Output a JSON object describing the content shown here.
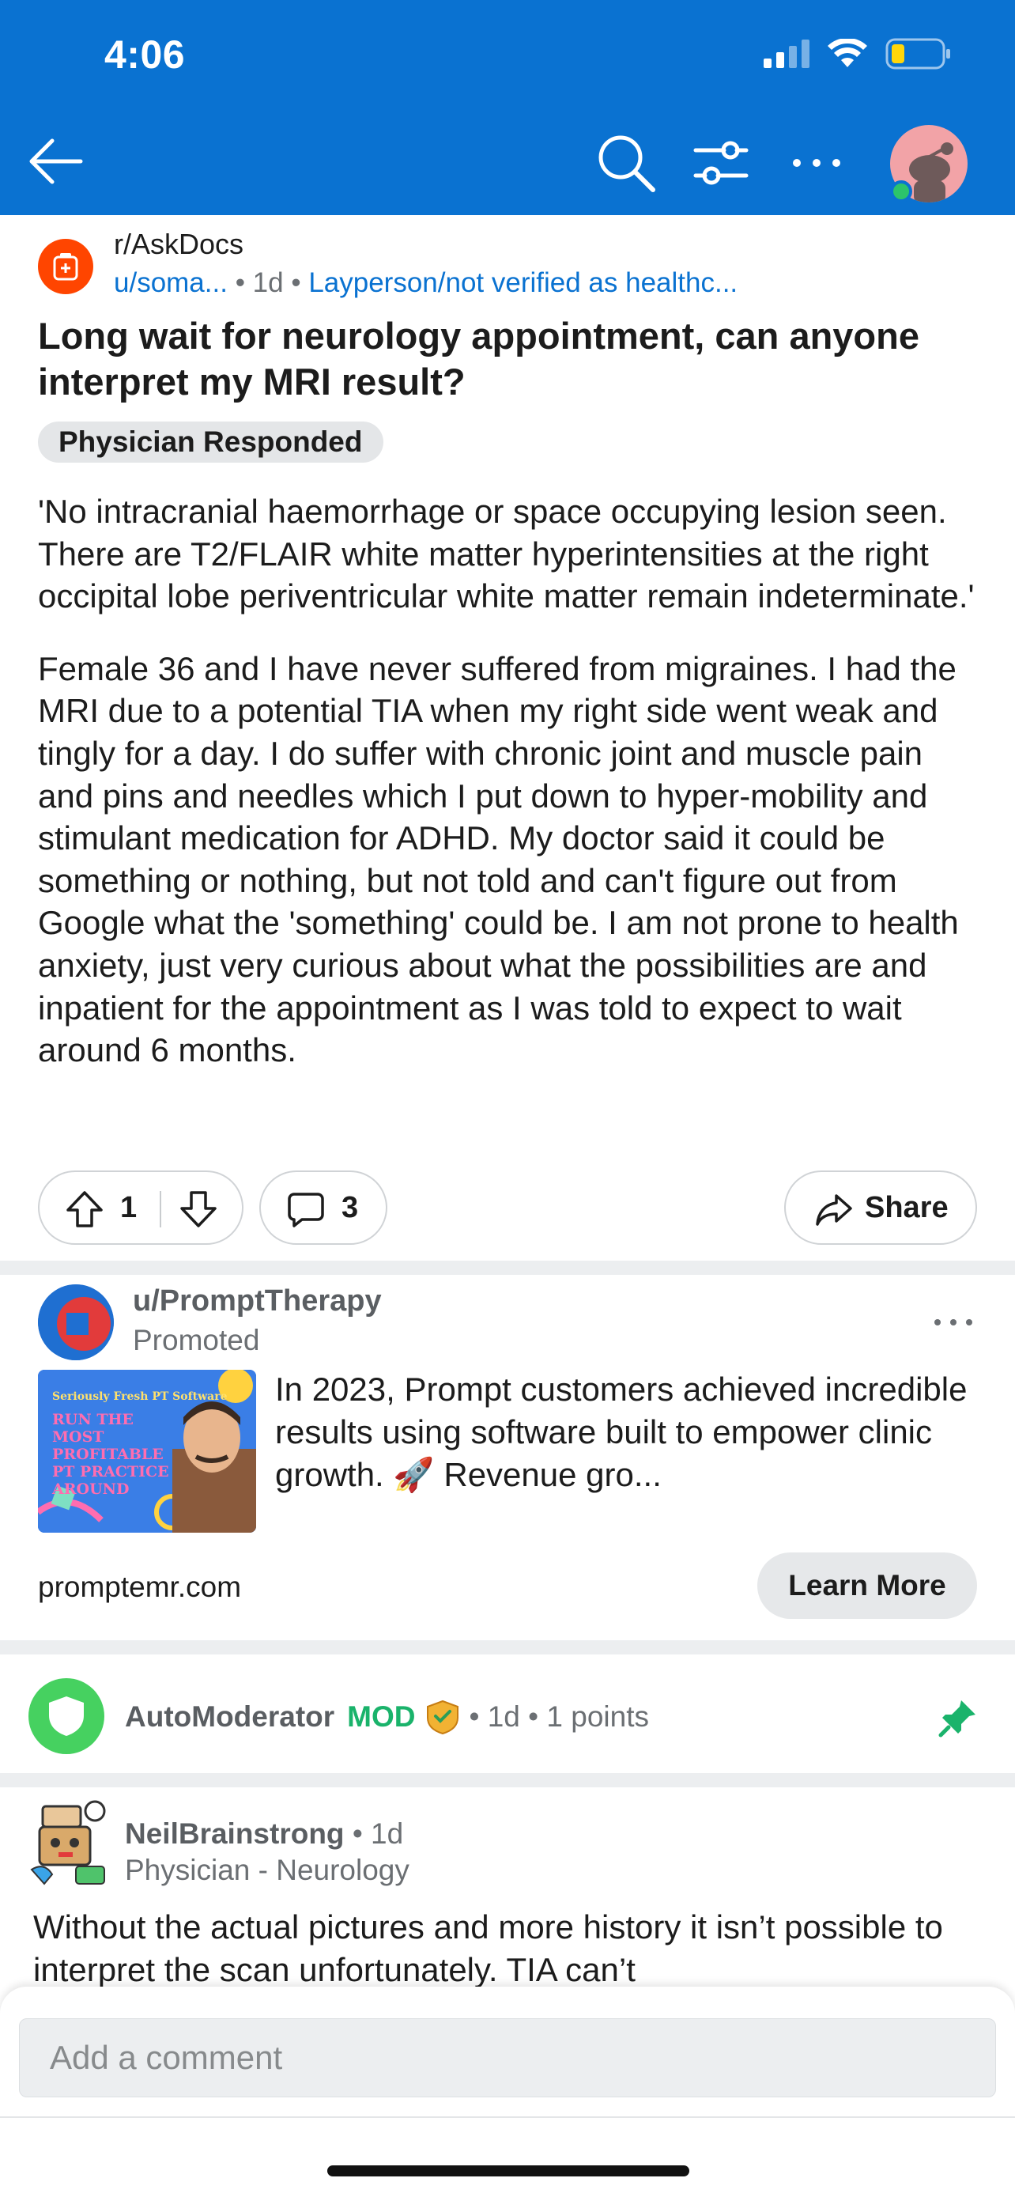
{
  "status_bar": {
    "time": "4:06"
  },
  "post": {
    "subreddit": "r/AskDocs",
    "author": "u/soma...",
    "time": "1d",
    "author_flair": "Layperson/not verified as healthc...",
    "title": "Long wait for neurology appointment, can anyone interpret my MRI result?",
    "flair": "Physician Responded",
    "body": [
      "'No intracranial haemorrhage or space occupying lesion seen. There are T2/FLAIR white matter hyperintensities at the right occipital lobe periventricular white matter remain indeterminate.'",
      "Female 36 and I have never suffered from migraines. I had the MRI due to a potential TIA when my right side went weak and tingly for a day. I do suffer with chronic joint and muscle pain and pins and needles which I put down to hyper-mobility and stimulant medication for ADHD. My doctor said it could be something or nothing, but not told and can't figure out from Google what the 'something' could be. I am not prone to health anxiety, just very curious about what the possibilities are and inpatient for the appointment as I was told to expect to wait around 6 months."
    ],
    "votes": "1",
    "comments": "3",
    "share_label": "Share"
  },
  "ad": {
    "user": "u/PromptTherapy",
    "label": "Promoted",
    "image_top_text": "Seriously Fresh PT Software",
    "image_main_text": "RUN THE MOST PROFITABLE PT PRACTICE AROUND",
    "text": "In 2023, Prompt customers achieved incredible results using software built to empower clinic growth. 🚀 Revenue gro...",
    "domain": "promptemr.com",
    "cta": "Learn More"
  },
  "automod": {
    "name": "AutoModerator",
    "mod_tag": "MOD",
    "meta": "• 1d • 1 points"
  },
  "comment": {
    "author": "NeilBrainstrong",
    "time": " • 1d",
    "flair": "Physician - Neurology",
    "text": "Without the actual pictures and more history it isn’t possible to interpret the scan unfortunately. TIA can’t"
  },
  "composer": {
    "placeholder": "Add a comment"
  },
  "colors": {
    "header": "#0a72d1",
    "subreddit_icon": "#ff4500",
    "mod_green": "#1ab36b"
  }
}
